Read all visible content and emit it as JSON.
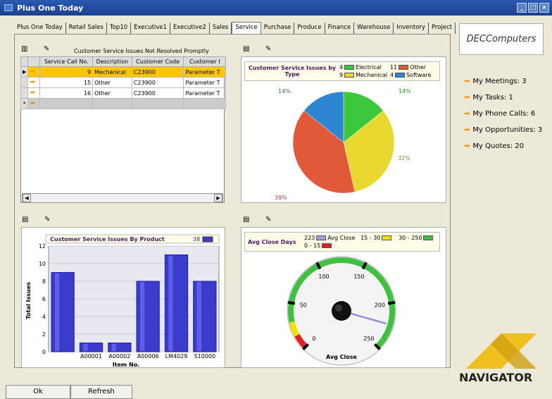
{
  "window": {
    "title": "Plus One Today"
  },
  "tabs": [
    "Plus One Today",
    "Retail Sales",
    "Top10",
    "Executive1",
    "Executive2",
    "Sales",
    "Service",
    "Purchase",
    "Produce",
    "Finance",
    "Warehouse",
    "Inventory",
    "Project"
  ],
  "active_tab": "Service",
  "grid": {
    "caption": "Customer Service Issues Not Resolved Promptly",
    "columns": [
      "Service Call No.",
      "Description",
      "Customer Code",
      "Customer I"
    ],
    "rows": [
      {
        "no": "9",
        "description": "Mechanical",
        "customer_code": "C23900",
        "customer": "Parameter T"
      },
      {
        "no": "15",
        "description": "Other",
        "customer_code": "C23900",
        "customer": "Parameter T"
      },
      {
        "no": "16",
        "description": "Other",
        "customer_code": "C23900",
        "customer": "Parameter T"
      }
    ],
    "new_row_marker": "*"
  },
  "pie_panel": {
    "title": "Customer Service Issues by Type",
    "legend": [
      {
        "count": "4",
        "label": "Electrical",
        "color": "#3cc83c"
      },
      {
        "count": "11",
        "label": "Other",
        "color": "#e05a3a"
      },
      {
        "count": "9",
        "label": "Mechanical",
        "color": "#e8d830"
      },
      {
        "count": "4",
        "label": "Software",
        "color": "#2e86d0"
      }
    ],
    "labels": [
      "14%",
      "14%",
      "32%",
      "39%"
    ]
  },
  "bar_panel": {
    "title": "Customer Service Issues By Product",
    "legend_count": "38"
  },
  "gauge_panel": {
    "title": "Avg Close Days",
    "legend": [
      {
        "text": "223",
        "label": "Avg Close",
        "color": "#a0a0e0"
      },
      {
        "text": "15 - 30",
        "label": "",
        "color": "#f0e000"
      },
      {
        "text": "30 - 250",
        "label": "",
        "color": "#40c040"
      },
      {
        "text": "0 - 15",
        "label": "",
        "color": "#e02020"
      }
    ],
    "ticks": [
      "0",
      "50",
      "100",
      "150",
      "200",
      "250"
    ],
    "caption": "Avg Close",
    "value": 223,
    "max": 250
  },
  "chart_data": {
    "type": "bar",
    "title": "Customer Service Issues By Product",
    "xlabel": "Item No.",
    "ylabel": "Total Issues",
    "categories": [
      "",
      "A00001",
      "A00002",
      "A00006",
      "LM4029",
      "S10000"
    ],
    "series": [
      {
        "name": "38",
        "values": [
          9,
          1,
          1,
          8,
          11,
          8
        ]
      }
    ],
    "ylim": [
      0,
      12
    ],
    "yticks": [
      0,
      2,
      4,
      6,
      8,
      10,
      12
    ],
    "color": "#3a3acc"
  },
  "sidebar": {
    "logo": "DECComputers",
    "items": [
      "My Meetings: 3",
      "My Tasks: 1",
      "My Phone Calls: 6",
      "My Opportunities: 3",
      "My Quotes: 20"
    ],
    "brand": "NAVIGATOR"
  },
  "buttons": {
    "ok": "Ok",
    "refresh": "Refresh"
  }
}
